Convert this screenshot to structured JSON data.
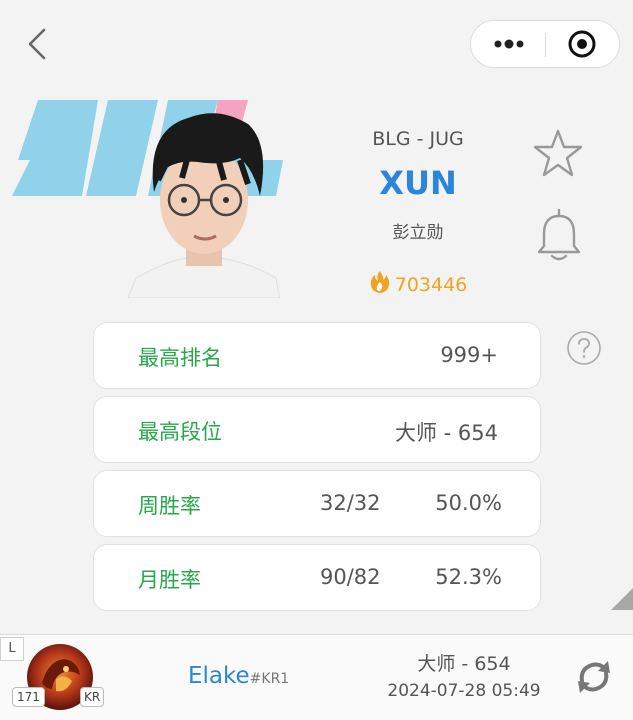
{
  "header": {
    "back_icon": "chevron-left-icon",
    "more_icon": "more-dots-icon",
    "close_icon": "target-close-icon"
  },
  "player": {
    "team_position": "BLG - JUG",
    "name": "XUN",
    "real_name": "彭立勋",
    "heat": "703446",
    "heat_icon": "fire-icon",
    "team_logo_color": "#8fd2ea",
    "team_logo_accent": "#f5a3c0"
  },
  "actions": {
    "star_icon": "star-outline-icon",
    "bell_icon": "bell-outline-icon",
    "help_icon": "question-circle-icon"
  },
  "stats": {
    "highest_rank": {
      "label": "最高排名",
      "value": "999+"
    },
    "highest_tier": {
      "label": "最高段位",
      "value": "大师 - 654"
    },
    "week_winrate": {
      "label": "周胜率",
      "games": "32/32",
      "rate": "50.0%"
    },
    "month_winrate": {
      "label": "月胜率",
      "games": "90/82",
      "rate": "52.3%"
    }
  },
  "colors": {
    "accent_blue": "#2a86d8",
    "label_green": "#27a84a",
    "heat_orange": "#f2a322"
  },
  "account": {
    "lane_badge": "L",
    "level": "171",
    "region": "KR",
    "summoner_name": "Elake",
    "tag": "#KR1",
    "rank": "大师 - 654",
    "updated_at": "2024-07-28 05:49",
    "refresh_icon": "refresh-icon"
  }
}
